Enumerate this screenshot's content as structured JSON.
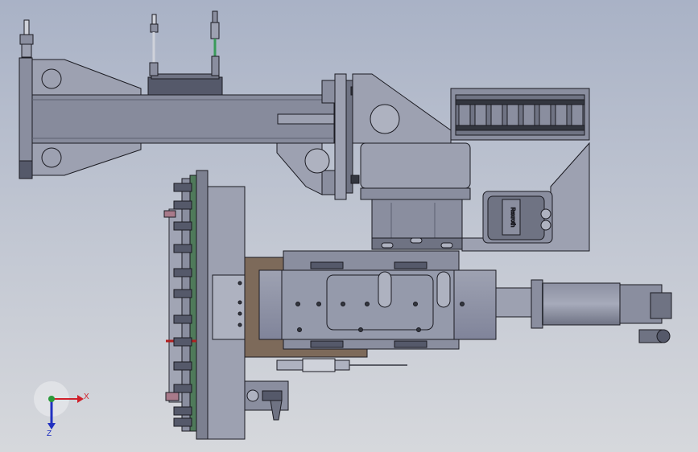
{
  "viewport": {
    "background_top": "#a9b2c6",
    "background_bottom": "#d6d8dc"
  },
  "colors": {
    "part_fill": "#8a8e9f",
    "part_fill_light": "#9da1b1",
    "part_fill_dark": "#6f7383",
    "edge": "#1b1b22",
    "plate_brown": "#7d6a5a",
    "cable_green": "#3a9a5a",
    "accent_red": "#b02020",
    "axis_x": "#d0202a",
    "axis_y": "#2a9a3a",
    "axis_z": "#2030c0"
  },
  "motor_brand": "Rexroth",
  "axis_triad": {
    "x_label": "X",
    "z_label": "Z"
  }
}
